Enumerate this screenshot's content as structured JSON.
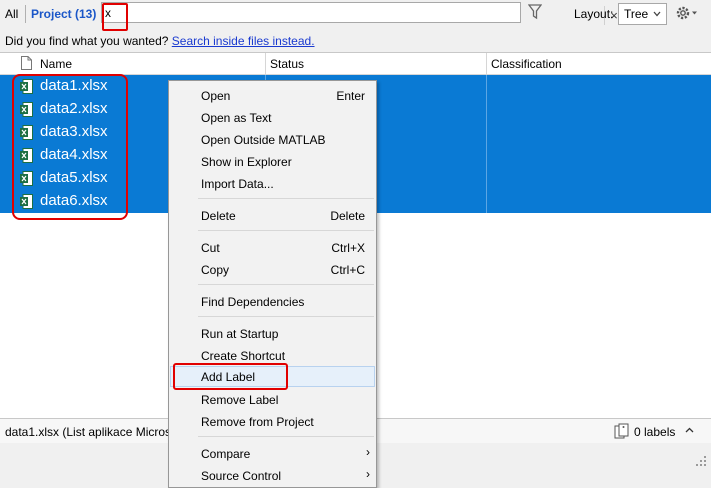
{
  "filter": {
    "all_label": "All",
    "project_label": "Project (13)",
    "search_value": "x",
    "clear_glyph": "×",
    "layout_label": "Layout:",
    "layout_value": "Tree"
  },
  "hint": {
    "text": "Did you find what you wanted?",
    "link": "Search inside files instead."
  },
  "table": {
    "columns": [
      "Name",
      "Status",
      "Classification"
    ],
    "rows": [
      {
        "name": "data1.xlsx"
      },
      {
        "name": "data2.xlsx"
      },
      {
        "name": "data3.xlsx"
      },
      {
        "name": "data4.xlsx"
      },
      {
        "name": "data5.xlsx"
      },
      {
        "name": "data6.xlsx"
      }
    ],
    "selection_color": "#0a7ad4"
  },
  "status": {
    "text": "data1.xlsx (List aplikace Micros",
    "labels_count": "0 labels"
  },
  "context_menu": {
    "items": [
      {
        "label": "Open",
        "shortcut": "Enter"
      },
      {
        "label": "Open as Text"
      },
      {
        "label": "Open Outside MATLAB"
      },
      {
        "label": "Show in Explorer"
      },
      {
        "label": "Import Data..."
      },
      {
        "label": "Delete",
        "shortcut": "Delete"
      },
      {
        "label": "Cut",
        "shortcut": "Ctrl+X"
      },
      {
        "label": "Copy",
        "shortcut": "Ctrl+C"
      },
      {
        "label": "Find Dependencies"
      },
      {
        "label": "Run at Startup"
      },
      {
        "label": "Create Shortcut"
      },
      {
        "label": "Add Label"
      },
      {
        "label": "Remove Label"
      },
      {
        "label": "Remove from Project"
      },
      {
        "label": "Compare",
        "submenu": "›"
      },
      {
        "label": "Source Control",
        "submenu": "›"
      }
    ]
  },
  "icons": {
    "funnel": "filter-funnel-icon",
    "gear": "gear-icon",
    "excel": "excel-file-icon",
    "label_tag": "label-tag-icon"
  }
}
